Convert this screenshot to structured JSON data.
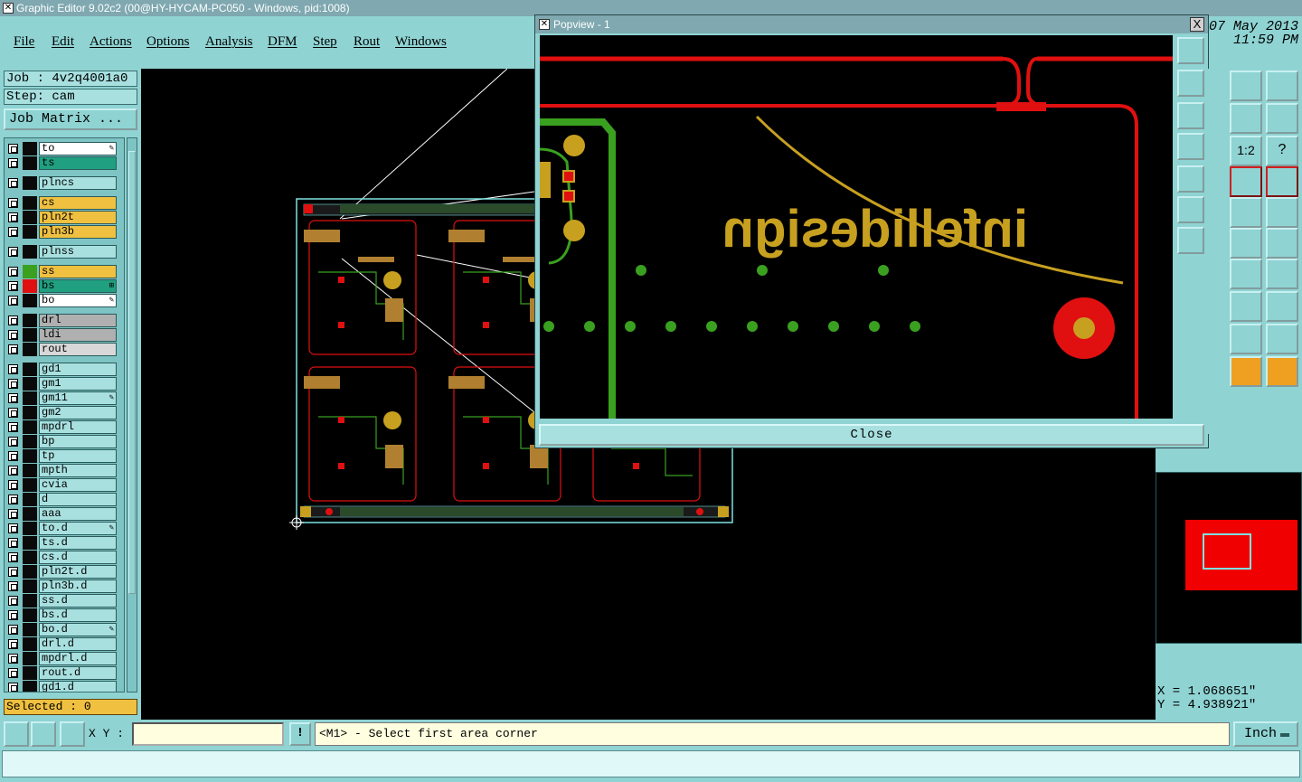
{
  "window": {
    "title": "Graphic Editor 9.02c2 (00@HY-HYCAM-PC050 - Windows, pid:1008)",
    "date": "07 May 2013",
    "time": "11:59 PM"
  },
  "menu": {
    "items": [
      "File",
      "Edit",
      "Actions",
      "Options",
      "Analysis",
      "DFM",
      "Step",
      "Rout",
      "Windows"
    ]
  },
  "job": {
    "job_label": "Job : 4v2q4001a0",
    "step_label": "Step: cam",
    "matrix_button": "Job Matrix ..."
  },
  "layers": [
    {
      "name": "to",
      "color": "#ffffff",
      "swatch": "#0a0a0a",
      "icon": "brush"
    },
    {
      "name": "ts",
      "color": "#20a080",
      "swatch": "#0a0a0a",
      "icon": ""
    },
    {
      "name": "plncs",
      "color": "#a8e0e0",
      "swatch": "#0a0a0a",
      "icon": ""
    },
    {
      "name": "cs",
      "color": "#f0c040",
      "swatch": "#0a0a0a",
      "icon": ""
    },
    {
      "name": "pln2t",
      "color": "#f0c040",
      "swatch": "#0a0a0a",
      "icon": ""
    },
    {
      "name": "pln3b",
      "color": "#f0c040",
      "swatch": "#0a0a0a",
      "icon": ""
    },
    {
      "name": "plnss",
      "color": "#a8e0e0",
      "swatch": "#0a0a0a",
      "icon": ""
    },
    {
      "name": "ss",
      "color": "#f0c040",
      "swatch": "#3aa020",
      "icon": ""
    },
    {
      "name": "bs",
      "color": "#20a080",
      "swatch": "#e01010",
      "icon": "grid"
    },
    {
      "name": "bo",
      "color": "#ffffff",
      "swatch": "#0a0a0a",
      "icon": "brush"
    },
    {
      "name": "drl",
      "color": "#b0b0b0",
      "swatch": "#0a0a0a",
      "icon": ""
    },
    {
      "name": "ldi",
      "color": "#b0b0b0",
      "swatch": "#0a0a0a",
      "icon": ""
    },
    {
      "name": "rout",
      "color": "#d8d8d8",
      "swatch": "#0a0a0a",
      "icon": ""
    },
    {
      "name": "gd1",
      "color": "#a8e0e0",
      "swatch": "#0a0a0a",
      "icon": ""
    },
    {
      "name": "gm1",
      "color": "#a8e0e0",
      "swatch": "#0a0a0a",
      "icon": ""
    },
    {
      "name": "gm11",
      "color": "#a8e0e0",
      "swatch": "#0a0a0a",
      "icon": "brush"
    },
    {
      "name": "gm2",
      "color": "#a8e0e0",
      "swatch": "#0a0a0a",
      "icon": ""
    },
    {
      "name": "mpdrl",
      "color": "#a8e0e0",
      "swatch": "#0a0a0a",
      "icon": ""
    },
    {
      "name": "bp",
      "color": "#a8e0e0",
      "swatch": "#0a0a0a",
      "icon": ""
    },
    {
      "name": "tp",
      "color": "#a8e0e0",
      "swatch": "#0a0a0a",
      "icon": ""
    },
    {
      "name": "mpth",
      "color": "#a8e0e0",
      "swatch": "#0a0a0a",
      "icon": ""
    },
    {
      "name": "cvia",
      "color": "#a8e0e0",
      "swatch": "#0a0a0a",
      "icon": ""
    },
    {
      "name": "d",
      "color": "#a8e0e0",
      "swatch": "#0a0a0a",
      "icon": ""
    },
    {
      "name": "aaa",
      "color": "#a8e0e0",
      "swatch": "#0a0a0a",
      "icon": ""
    },
    {
      "name": "to.d",
      "color": "#a8e0e0",
      "swatch": "#0a0a0a",
      "icon": "brush"
    },
    {
      "name": "ts.d",
      "color": "#a8e0e0",
      "swatch": "#0a0a0a",
      "icon": ""
    },
    {
      "name": "cs.d",
      "color": "#a8e0e0",
      "swatch": "#0a0a0a",
      "icon": ""
    },
    {
      "name": "pln2t.d",
      "color": "#a8e0e0",
      "swatch": "#0a0a0a",
      "icon": ""
    },
    {
      "name": "pln3b.d",
      "color": "#a8e0e0",
      "swatch": "#0a0a0a",
      "icon": ""
    },
    {
      "name": "ss.d",
      "color": "#a8e0e0",
      "swatch": "#0a0a0a",
      "icon": ""
    },
    {
      "name": "bs.d",
      "color": "#a8e0e0",
      "swatch": "#0a0a0a",
      "icon": ""
    },
    {
      "name": "bo.d",
      "color": "#a8e0e0",
      "swatch": "#0a0a0a",
      "icon": "brush"
    },
    {
      "name": "drl.d",
      "color": "#a8e0e0",
      "swatch": "#0a0a0a",
      "icon": ""
    },
    {
      "name": "mpdrl.d",
      "color": "#a8e0e0",
      "swatch": "#0a0a0a",
      "icon": ""
    },
    {
      "name": "rout.d",
      "color": "#a8e0e0",
      "swatch": "#0a0a0a",
      "icon": ""
    },
    {
      "name": "gd1.d",
      "color": "#a8e0e0",
      "swatch": "#0a0a0a",
      "icon": ""
    }
  ],
  "selected_label": "Selected : 0",
  "popview": {
    "title": "Popview - 1",
    "close_label": "Close",
    "close_x": "X",
    "board_text": "infellidesign"
  },
  "tools": {
    "scale_label": "1:2",
    "help_label": "?"
  },
  "coords": {
    "x": "X = 1.068651\"",
    "y": "Y = 4.938921\""
  },
  "bottom": {
    "xy_label": "X Y :",
    "xy_value": "",
    "excl_label": "!",
    "message": "<M1> - Select first area corner",
    "units": "Inch"
  },
  "colors": {
    "ui_bg": "#8fd3d3",
    "trace_red": "#e01010",
    "trace_green": "#3aa020",
    "pad_gold": "#c8a020",
    "outline_cyan": "#80e0e0"
  }
}
